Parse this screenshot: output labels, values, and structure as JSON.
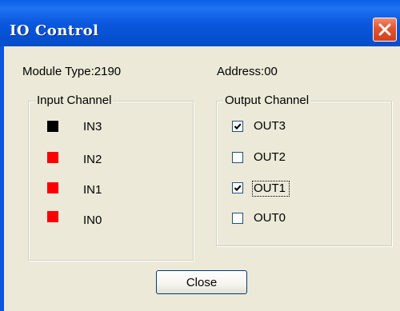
{
  "window": {
    "title": "IO Control",
    "close_icon": "close-x-icon",
    "accent": "#0a55dc",
    "close_color": "#e2542e"
  },
  "info": {
    "module_type": "Module Type:2190",
    "address": "Address:00"
  },
  "input_group": {
    "title": "Input Channel",
    "channels": [
      {
        "label": "IN3",
        "state": "off",
        "color": "#000000"
      },
      {
        "label": "IN2",
        "state": "on",
        "color": "#ff0000"
      },
      {
        "label": "IN1",
        "state": "on",
        "color": "#ff0000"
      },
      {
        "label": "IN0",
        "state": "on",
        "color": "#ff0000"
      }
    ]
  },
  "output_group": {
    "title": "Output Channel",
    "channels": [
      {
        "label": "OUT3",
        "checked": true
      },
      {
        "label": "OUT2",
        "checked": false
      },
      {
        "label": "OUT1",
        "checked": true,
        "focused": true
      },
      {
        "label": "OUT0",
        "checked": false
      }
    ]
  },
  "buttons": {
    "close_label": "Close"
  }
}
